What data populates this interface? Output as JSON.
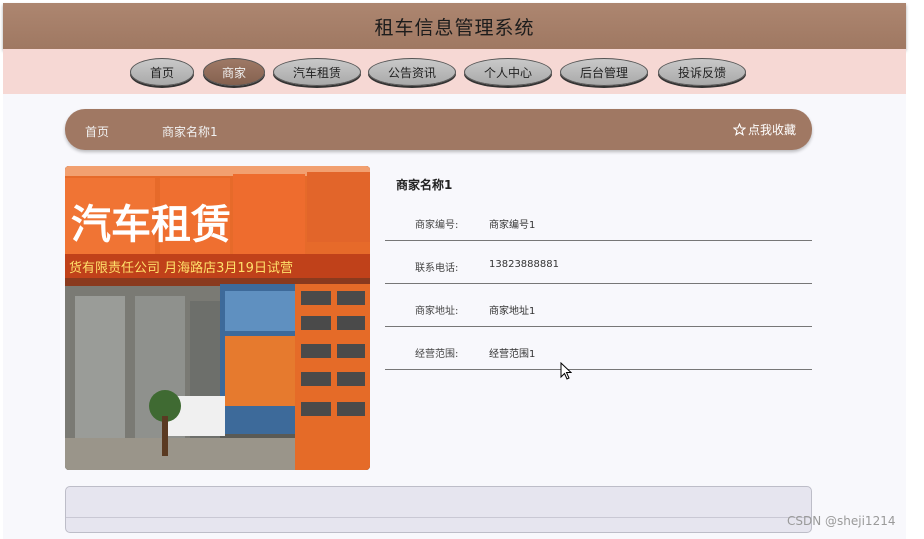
{
  "header": {
    "title": "租车信息管理系统"
  },
  "nav": {
    "items": [
      {
        "label": "首页"
      },
      {
        "label": "商家"
      },
      {
        "label": "汽车租赁"
      },
      {
        "label": "公告资讯"
      },
      {
        "label": "个人中心"
      },
      {
        "label": "后台管理"
      },
      {
        "label": "投诉反馈"
      }
    ],
    "active_index": 1
  },
  "breadcrumb": {
    "home": "首页",
    "current": "商家名称1",
    "favorite_label": "点我收藏",
    "favorite_icon": "star-outline-icon"
  },
  "merchant": {
    "name": "商家名称1",
    "fields": [
      {
        "label": "商家编号:",
        "value": "商家编号1"
      },
      {
        "label": "联系电话:",
        "value": "13823888881"
      },
      {
        "label": "商家地址:",
        "value": "商家地址1"
      },
      {
        "label": "经营范围:",
        "value": "经营范围1"
      }
    ],
    "photo": {
      "sign_text": "汽车租赁",
      "banner_text": "货有限责任公司 月海路店3月19日试营"
    }
  },
  "watermark": "CSDN @sheji1214",
  "colors": {
    "header": "#a07863",
    "nav_bg": "#f6d8d4",
    "content_bg": "#f8f8fc",
    "active_nav": "#8e6a57"
  }
}
